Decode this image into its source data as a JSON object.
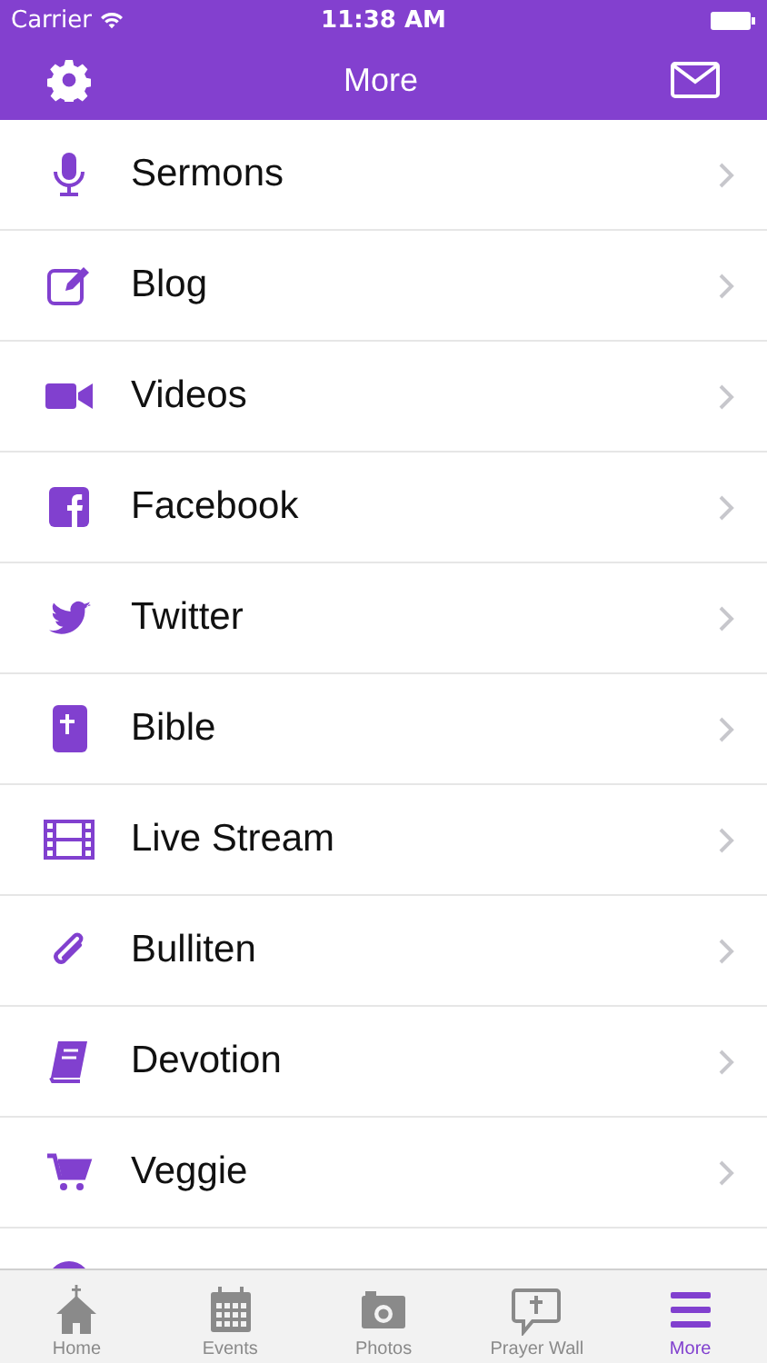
{
  "status_bar": {
    "carrier": "Carrier",
    "time": "11:38 AM"
  },
  "nav_bar": {
    "title": "More"
  },
  "menu": [
    {
      "kind": "mic",
      "label": "Sermons"
    },
    {
      "kind": "pencil",
      "label": "Blog"
    },
    {
      "kind": "video",
      "label": "Videos"
    },
    {
      "kind": "facebook",
      "label": "Facebook"
    },
    {
      "kind": "bird",
      "label": "Twitter"
    },
    {
      "kind": "bible",
      "label": "Bible"
    },
    {
      "kind": "film",
      "label": "Live Stream"
    },
    {
      "kind": "clip",
      "label": "Bulliten"
    },
    {
      "kind": "book",
      "label": "Devotion"
    },
    {
      "kind": "cart",
      "label": "Veggie"
    },
    {
      "kind": "info"
    }
  ],
  "tab_bar": [
    {
      "kind": "home",
      "label": "Home",
      "selected": false
    },
    {
      "kind": "calendar",
      "label": "Events",
      "selected": false
    },
    {
      "kind": "camera",
      "label": "Photos",
      "selected": false
    },
    {
      "kind": "prayer",
      "label": "Prayer Wall",
      "selected": false
    },
    {
      "kind": "menu",
      "label": "More",
      "selected": true
    }
  ]
}
